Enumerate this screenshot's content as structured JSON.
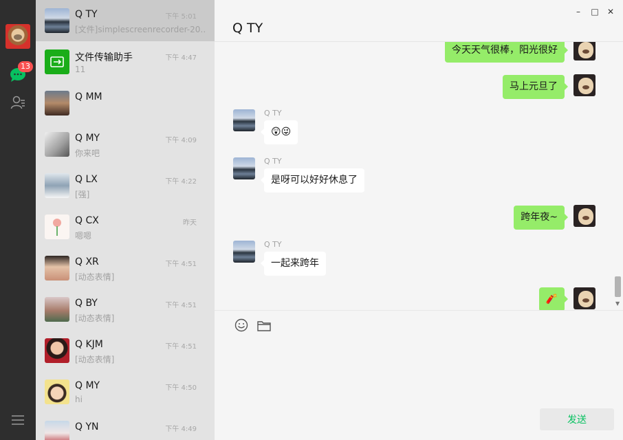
{
  "sidebar": {
    "chat_badge": "13",
    "colors": {
      "background": "#2e2e2e",
      "accent": "#07c160",
      "badge": "#fa5151"
    }
  },
  "conversations": [
    {
      "name": "Q TY",
      "time": "下午 5:01",
      "preview": "[文件]simplescreenrecorder-20…",
      "avatar": "lake-photo",
      "active": true
    },
    {
      "name": "文件传输助手",
      "time": "下午 4:47",
      "preview": "11",
      "avatar": "file-transfer-icon"
    },
    {
      "name": "Q MM",
      "time": "",
      "preview": "",
      "avatar": "portrait-photo"
    },
    {
      "name": "Q MY",
      "time": "下午 4:09",
      "preview": "你来吧",
      "avatar": "portrait-photo"
    },
    {
      "name": "Q LX",
      "time": "下午 4:22",
      "preview": "[强]",
      "avatar": "dog-photo"
    },
    {
      "name": "Q CX",
      "time": "昨天",
      "preview": "嗯嗯",
      "avatar": "flower-drawing"
    },
    {
      "name": "Q XR",
      "time": "下午 4:51",
      "preview": "[动态表情]",
      "avatar": "portrait-photo"
    },
    {
      "name": "Q BY",
      "time": "下午 4:51",
      "preview": "[动态表情]",
      "avatar": "portrait-photo"
    },
    {
      "name": "Q KJM",
      "time": "下午 4:51",
      "preview": "[动态表情]",
      "avatar": "portrait-photo"
    },
    {
      "name": "Q MY",
      "time": "下午 4:50",
      "preview": "hi",
      "avatar": "cartoon-avatar"
    },
    {
      "name": "Q YN",
      "time": "下午 4:49",
      "preview": "",
      "avatar": "portrait-photo"
    }
  ],
  "chat": {
    "title": "Q TY",
    "messages": [
      {
        "direction": "out",
        "text": "今天天气很棒，阳光很好"
      },
      {
        "direction": "out",
        "text": "马上元旦了"
      },
      {
        "direction": "in",
        "sender": "Q TY",
        "text": "😲😜"
      },
      {
        "direction": "in",
        "sender": "Q TY",
        "text": "是呀可以好好休息了"
      },
      {
        "direction": "out",
        "text": "跨年夜~"
      },
      {
        "direction": "in",
        "sender": "Q TY",
        "text": "一起来跨年"
      },
      {
        "direction": "out",
        "text": "🧨"
      }
    ],
    "send_label": "发送"
  }
}
